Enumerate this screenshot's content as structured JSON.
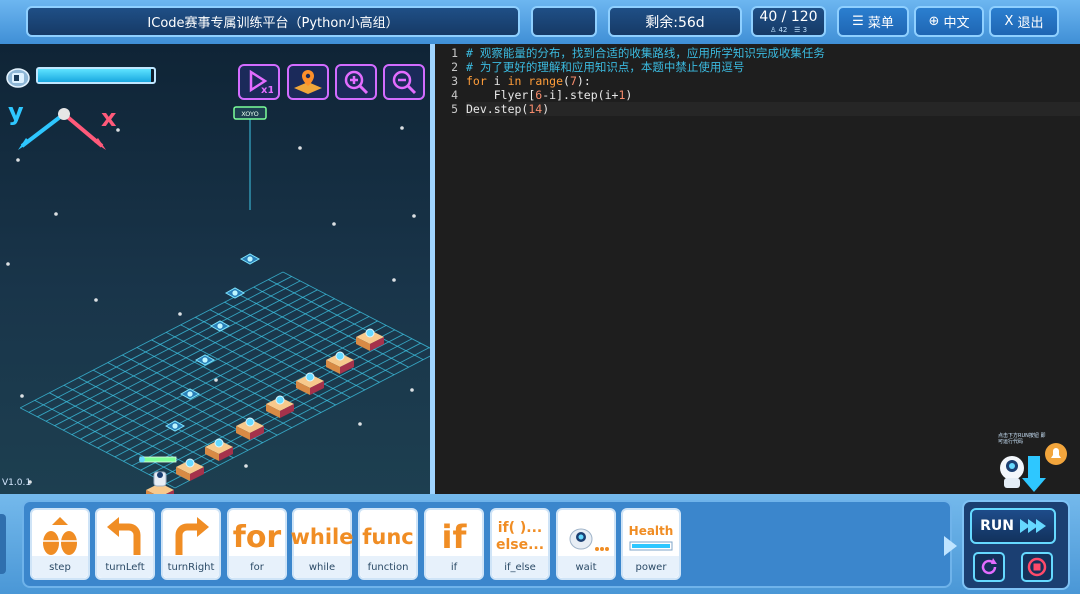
{
  "header": {
    "title": "ICode赛事专属训练平台（Python小高组）",
    "remaining": "剩余:56d",
    "progress": "40 / 120",
    "progress_sub_left": "42",
    "progress_sub_right": "3",
    "menu_label": "菜单",
    "lang_label": "中文",
    "exit_label": "退出"
  },
  "game": {
    "energy_level": 0.97,
    "axis_y_label": "y",
    "axis_x_label": "x",
    "version": "V1.0.1",
    "tag_label": "XOYO"
  },
  "editor": {
    "line_numbers": [
      "1",
      "2",
      "3",
      "4",
      "5"
    ],
    "lines": [
      "# 观察能量的分布，找到合适的收集路线，应用所学知识完成收集任务",
      "# 为了更好的理解和应用知识点，本题中禁止使用逗号",
      "for i in range(7):",
      "    Flyer[6-i].step(i+1)",
      "Dev.step(14)"
    ],
    "helper_text": "点击下方RUN按钮 即可运行代码"
  },
  "blocks": [
    {
      "label": "step"
    },
    {
      "label": "turnLeft"
    },
    {
      "label": "turnRight"
    },
    {
      "label": "for",
      "glyph": "for"
    },
    {
      "label": "while",
      "glyph": "while"
    },
    {
      "label": "function",
      "glyph": "func"
    },
    {
      "label": "if",
      "glyph": "if"
    },
    {
      "label": "if_else",
      "glyph_top": "if( )...",
      "glyph_bottom": "else..."
    },
    {
      "label": "wait"
    },
    {
      "label": "power",
      "glyph": "Health"
    }
  ],
  "run": {
    "label": "RUN"
  },
  "colors": {
    "accent_orange": "#f08d24",
    "code_comment": "#3bbbe0",
    "code_keyword": "#ff9d3a",
    "grid_cyan": "#3ec6e6"
  }
}
